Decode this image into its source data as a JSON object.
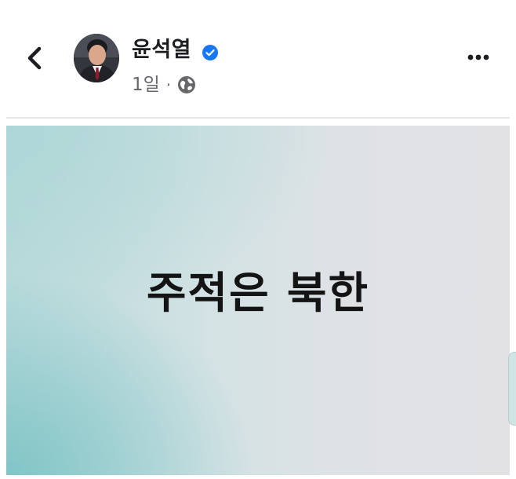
{
  "post": {
    "author_name": "윤석열",
    "time": "1일",
    "separator": "·",
    "image_text": "주적은 북한"
  },
  "icons": {
    "back": "chevron-left-icon",
    "verified": "verified-badge-icon",
    "privacy": "globe-icon",
    "more": "more-horizontal-icon"
  },
  "colors": {
    "verified_badge": "#1877f2",
    "meta_text": "#65676b",
    "name_text": "#1c1e21"
  }
}
